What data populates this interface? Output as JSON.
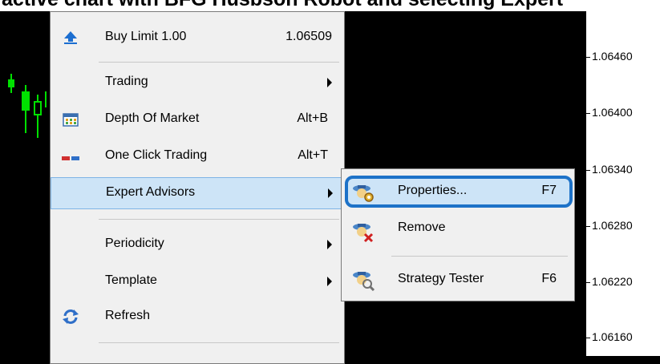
{
  "caption": {
    "text": "active chart with BFG Husbson Robot and selecting Expert"
  },
  "price_axis": {
    "labels": [
      "1.06460",
      "1.06400",
      "1.06340",
      "1.06280",
      "1.06220",
      "1.06160"
    ]
  },
  "colors": {
    "candle": "#00e000",
    "menu_bg": "#f0f0f0",
    "highlight": "#cde4f7",
    "callout": "#1d72c8"
  },
  "menu": {
    "buy_limit": {
      "label": "Buy Limit 1.00",
      "price": "1.06509",
      "icon": "up-arrow-icon"
    },
    "trading": {
      "label": "Trading"
    },
    "depth_of_market": {
      "label": "Depth Of Market",
      "shortcut": "Alt+B",
      "icon": "table-icon"
    },
    "one_click": {
      "label": "One Click Trading",
      "shortcut": "Alt+T",
      "icon": "one-click-trading-icon"
    },
    "expert_advisors": {
      "label": "Expert Advisors"
    },
    "periodicity": {
      "label": "Periodicity"
    },
    "template": {
      "label": "Template"
    },
    "refresh": {
      "label": "Refresh",
      "icon": "refresh-icon"
    }
  },
  "submenu": {
    "properties": {
      "label": "Properties...",
      "shortcut": "F7",
      "icon": "expert-properties-icon"
    },
    "remove": {
      "label": "Remove",
      "icon": "expert-remove-icon"
    },
    "strategy_tester": {
      "label": "Strategy Tester",
      "shortcut": "F6",
      "icon": "strategy-tester-icon"
    }
  }
}
